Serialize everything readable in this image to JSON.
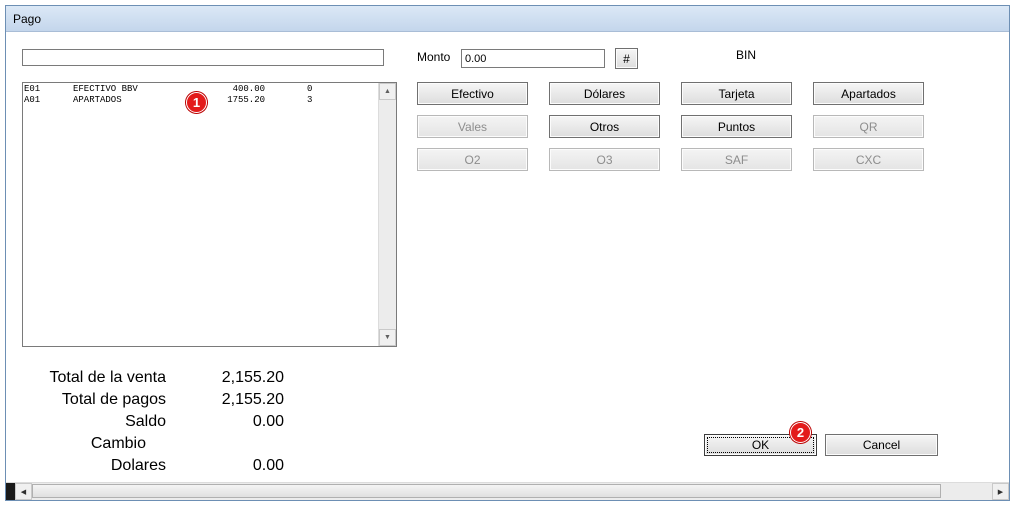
{
  "window": {
    "title": "Pago"
  },
  "search": {
    "value": ""
  },
  "payments_list": {
    "rows": [
      {
        "code": "E01",
        "description": "EFECTIVO BBV",
        "amount": "400.00",
        "count": "0"
      },
      {
        "code": "A01",
        "description": "APARTADOS",
        "amount": "1755.20",
        "count": "3"
      }
    ],
    "marker": "1"
  },
  "monto": {
    "label": "Monto",
    "value": "0.00",
    "hash_label": "#"
  },
  "bin": {
    "label": "BIN"
  },
  "payment_buttons": [
    {
      "label": "Efectivo",
      "enabled": true
    },
    {
      "label": "Dólares",
      "enabled": true
    },
    {
      "label": "Tarjeta",
      "enabled": true
    },
    {
      "label": "Apartados",
      "enabled": true
    },
    {
      "label": "Vales",
      "enabled": false
    },
    {
      "label": "Otros",
      "enabled": true
    },
    {
      "label": "Puntos",
      "enabled": true
    },
    {
      "label": "QR",
      "enabled": false
    },
    {
      "label": "O2",
      "enabled": false
    },
    {
      "label": "O3",
      "enabled": false
    },
    {
      "label": "SAF",
      "enabled": false
    },
    {
      "label": "CXC",
      "enabled": false
    }
  ],
  "totals": [
    {
      "label": "Total de la venta",
      "value": "2,155.20"
    },
    {
      "label": "Total de pagos",
      "value": "2,155.20"
    },
    {
      "label": "Saldo",
      "value": "0.00"
    },
    {
      "label": "Cambio",
      "value": ""
    },
    {
      "label": "Dolares",
      "value": "0.00"
    }
  ],
  "actions": {
    "ok_label": "OK",
    "cancel_label": "Cancel",
    "marker": "2"
  },
  "colors": {
    "marker": "#e31b1b",
    "titlebar": "#c4d6ec",
    "border": "#6d8fb4"
  }
}
